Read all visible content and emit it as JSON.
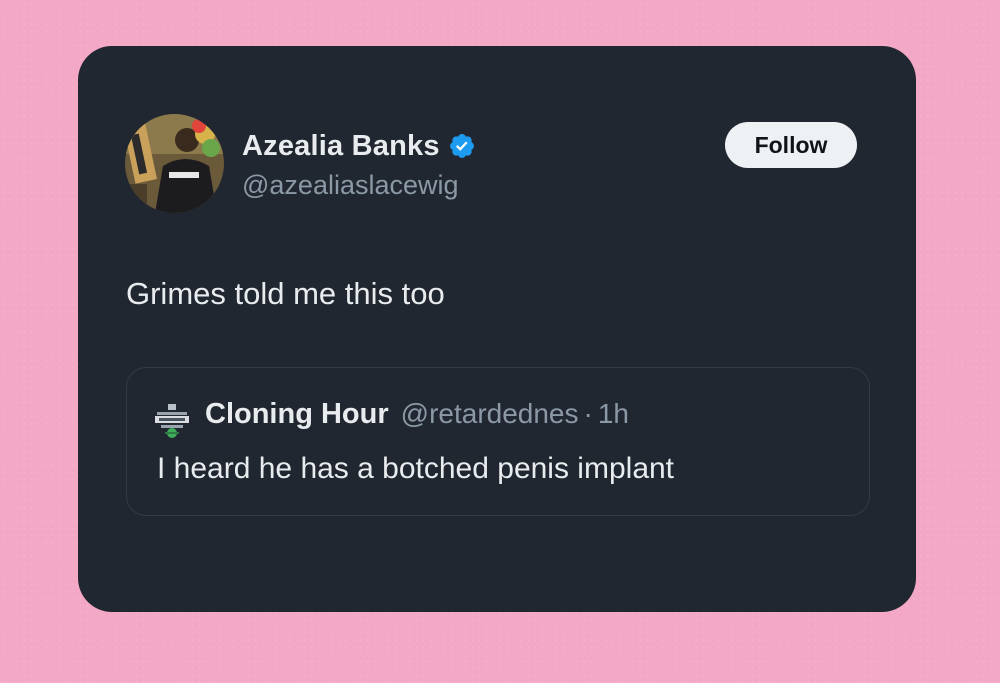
{
  "tweet": {
    "author": {
      "display_name": "Azealia Banks",
      "handle": "@azealiaslacewig",
      "verified_icon": "verified-badge-icon",
      "avatar_icon": "profile-photo"
    },
    "follow_label": "Follow",
    "text": "Grimes told me this too",
    "quoted": {
      "author_name": "Cloning Hour",
      "handle": "@retardednes",
      "separator": "·",
      "time": "1h",
      "avatar_icon": "cloning-hour-logo",
      "text": "I heard he has a botched penis implant"
    }
  },
  "colors": {
    "background": "#f3a9c6",
    "card": "#212730",
    "text_primary": "#e9ecef",
    "text_secondary": "#8b98a5",
    "verified_blue": "#1d9bf0",
    "button_bg": "#eef1f3"
  }
}
